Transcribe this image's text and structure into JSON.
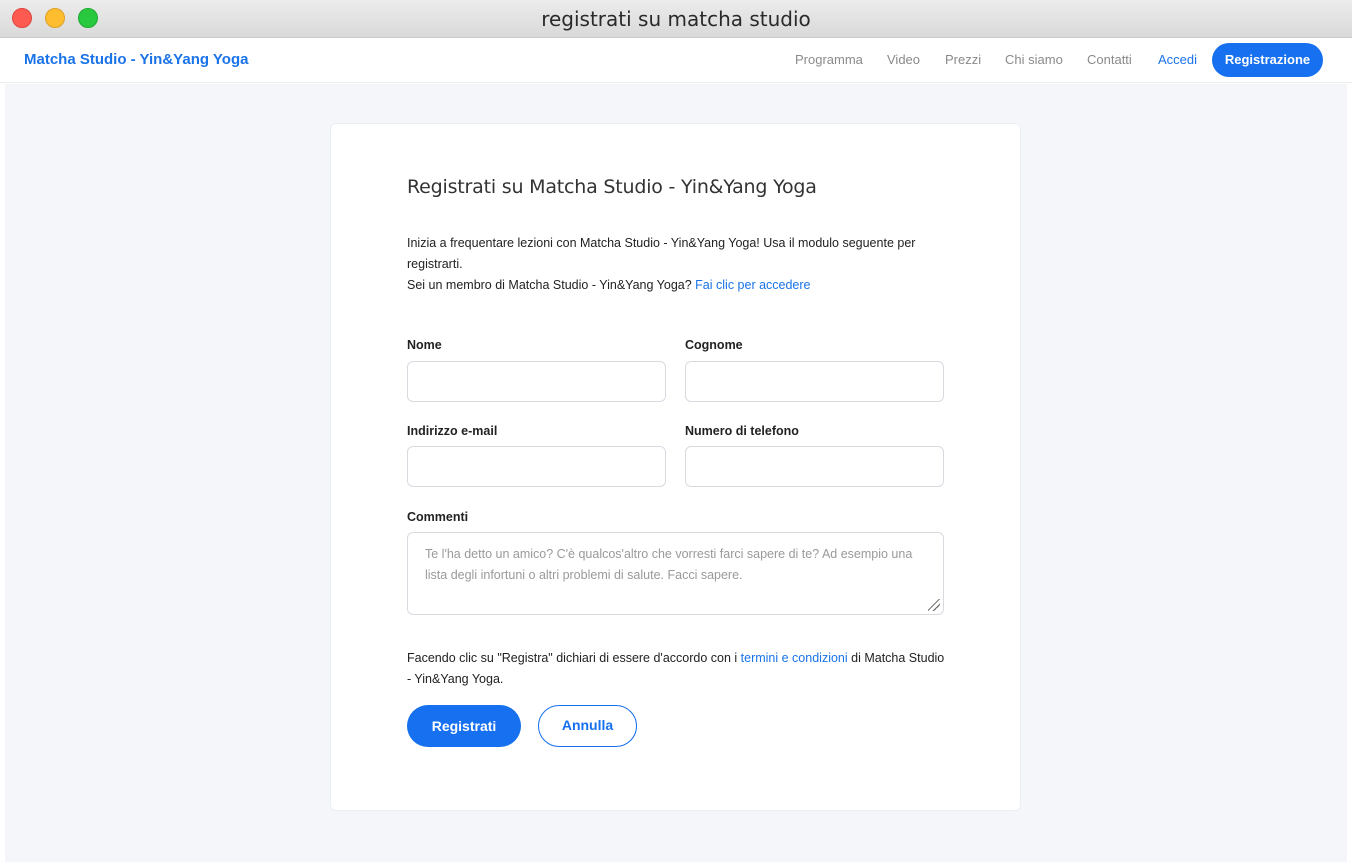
{
  "window": {
    "title": "registrati su matcha studio"
  },
  "navbar": {
    "brand": "Matcha Studio - Yin&Yang Yoga",
    "links": [
      {
        "label": "Programma"
      },
      {
        "label": "Video"
      },
      {
        "label": "Prezzi"
      },
      {
        "label": "Chi siamo"
      },
      {
        "label": "Contatti"
      },
      {
        "label": "Accedi"
      }
    ],
    "register_label": "Registrazione"
  },
  "form": {
    "title": "Registrati su Matcha Studio - Yin&Yang Yoga",
    "intro_line1": "Inizia a frequentare lezioni con Matcha Studio - Yin&Yang Yoga! Usa il modulo seguente per registrarti.",
    "intro_member_text": "Sei un membro di Matcha Studio - Yin&Yang Yoga?",
    "intro_member_link": "Fai clic per accedere",
    "fields": {
      "first_name": {
        "label": "Nome",
        "value": ""
      },
      "last_name": {
        "label": "Cognome",
        "value": ""
      },
      "email": {
        "label": "Indirizzo e-mail",
        "value": ""
      },
      "phone": {
        "label": "Numero di telefono",
        "value": ""
      },
      "comments": {
        "label": "Commenti",
        "value": "",
        "placeholder": "Te l'ha detto un amico? C'è qualcos'altro che vorresti farci sapere di te? Ad esempio una lista degli infortuni o altri problemi di salute. Facci sapere."
      }
    },
    "terms_prefix": "Facendo clic su \"Registra\" dichiari di essere d'accordo con i",
    "terms_link": "termini e condizioni",
    "terms_suffix": "di Matcha Studio - Yin&Yang Yoga.",
    "submit_label": "Registrati",
    "cancel_label": "Annulla"
  },
  "colors": {
    "accent": "#1670f0",
    "link": "#1a73e8",
    "page_background": "#f4f6f9"
  }
}
